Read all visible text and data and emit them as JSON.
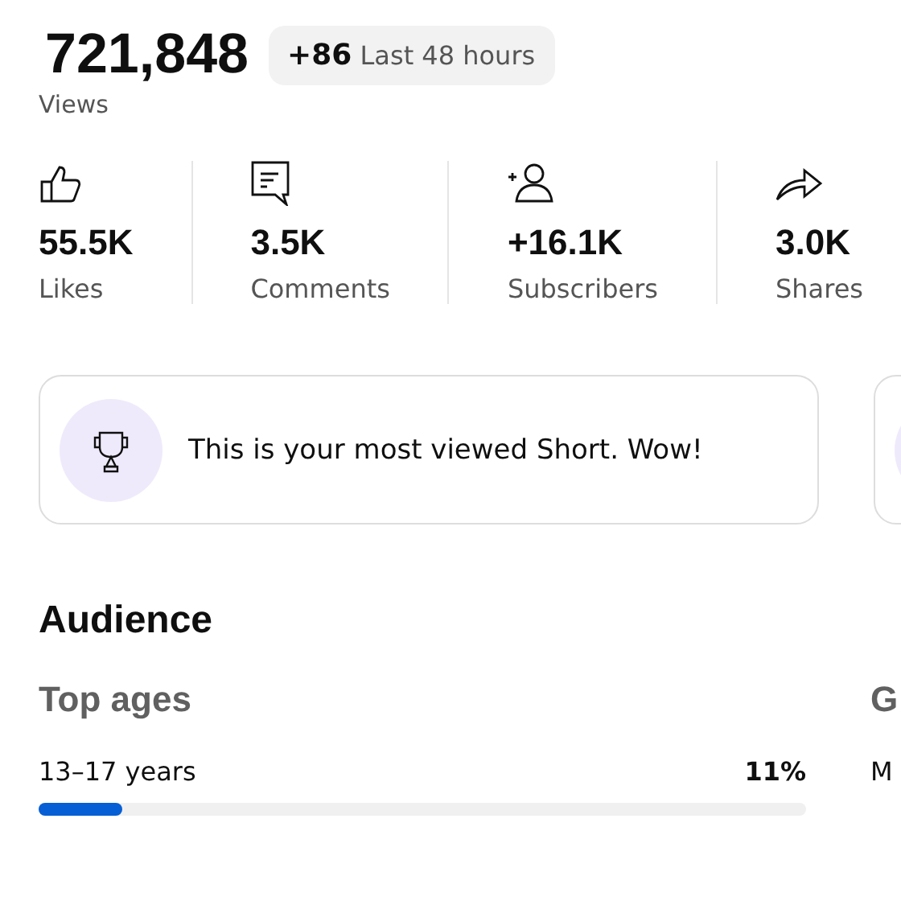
{
  "views": {
    "value": "721,848",
    "label": "Views",
    "badge": {
      "delta": "+86",
      "period": "Last 48 hours"
    }
  },
  "stats": [
    {
      "kind": "like",
      "value": "55.5K",
      "label": "Likes"
    },
    {
      "kind": "comment",
      "value": "3.5K",
      "label": "Comments"
    },
    {
      "kind": "subscriber",
      "value": "+16.1K",
      "label": "Subscribers"
    },
    {
      "kind": "share",
      "value": "3.0K",
      "label": "Shares"
    }
  ],
  "cards": [
    {
      "kind": "insight",
      "text": "This is your most viewed Short. Wow!"
    },
    {
      "kind": "cut_off"
    }
  ],
  "audience": {
    "title": "Audience",
    "groups": [
      {
        "title": "Top ages",
        "rows": [
          {
            "label": "13–17 years",
            "percent": "11%",
            "level": 0.11
          }
        ]
      },
      {
        "title": "G",
        "rows": [
          {
            "label": "M"
          }
        ]
      }
    ]
  }
}
